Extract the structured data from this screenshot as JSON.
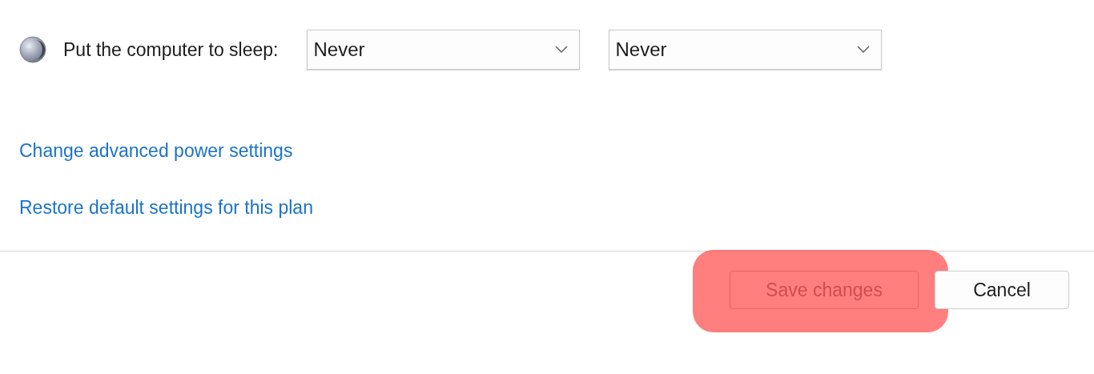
{
  "sleep_setting": {
    "label": "Put the computer to sleep:",
    "dropdowns": [
      {
        "value": "Never"
      },
      {
        "value": "Never"
      }
    ]
  },
  "links": [
    "Change advanced power settings",
    "Restore default settings for this plan"
  ],
  "buttons": [
    {
      "label": "Save changes",
      "highlighted": true
    },
    {
      "label": "Cancel",
      "highlighted": false
    }
  ]
}
